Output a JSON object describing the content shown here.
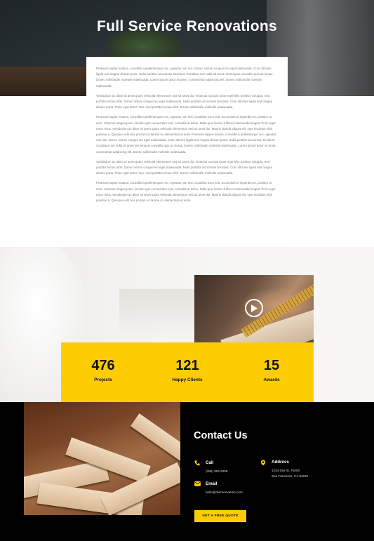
{
  "hero": {
    "title": "Full Service Renovations"
  },
  "content": {
    "paragraphs": [
      "Praesent sapien massa, convallis a pellentesque nec, egestas non nisi. Donec rutrum congue leo eget malesuada. Cras ultricies ligula sed magna dictum porta. Nulla porttitor accumsan tincidunt. Curabitur non nulla sit amet nisl tempus convallis quis ac lectus. Donec sollicitudin molestie malesuada. Lorem ipsum dolor sit amet, consectetur adipiscing elit. Donec sollicitudin molestie malesuada.",
      "Vestibulum ac diam sit amet quam vehicula elementum sed sit amet dui. Vivamus suscipit tortor eget felis porttitor volutpat. Sed porttitor lectus nibh. Donec rutrum congue leo eget malesuada. Nulla porttitor accumsan tincidunt. Cras ultricies ligula sed magna dictum porta. Proin eget tortor risus. Sed porttitor lectus nibh. Donec sollicitudin molestie malesuada.",
      "Praesent sapien massa, convallis a pellentesque nec, egestas non nisi. Curabitur arcu erat, accumsan id imperdiet et, porttitor at sem. Vivamus magna justo, lacinia eget consectetur sed, convallis at tellus. Nulla quis lorem ut libero malesuada feugiat. Proin eget tortor risus. Vestibulum ac diam sit amet quam vehicula elementum sed sit amet dui. Mauris blandit aliquet elit, eget tincidunt nibh pulvinar a. Quisque velit nisi, pretium ut lacinia in, elementum id enim Praesent sapien massa, convallis a pellentesque nec, egestas non nisi. Donec rutrum congue leo eget malesuada. Cras ultricies ligula sed magna dictum porta. Nulla porttitor accumsan tincidunt. Curabitur non nulla sit amet nisl tempus convallis quis ac lectus. Donec sollicitudin molestie malesuada. Lorem ipsum dolor sit amet, consectetur adipiscing elit. Donec sollicitudin molestie malesuada.",
      "Vestibulum ac diam sit amet quam vehicula elementum sed sit amet dui. Vivamus suscipit tortor eget felis porttitor volutpat. Sed porttitor lectus nibh. Donec rutrum congue leo eget malesuada. Nulla porttitor accumsan tincidunt. Cras ultricies ligula sed magna dictum porta. Proin eget tortor risus. Sed porttitor lectus nibh. Donec sollicitudin molestie malesuada.",
      "Praesent sapien massa, convallis a pellentesque nec, egestas non nisi. Curabitur arcu erat, accumsan id imperdiet et, porttitor at sem. Vivamus magna justo, lacinia eget consectetur sed, convallis at tellus. Nulla quis lorem ut libero malesuada feugiat. Proin eget tortor risus. Vestibulum ac diam sit amet quam vehicula elementum sed sit amet dui. Mauris blandit aliquet elit, eget tincidunt nibh pulvinar a. Quisque velit nisi, pretium ut lacinia in, elementum id enim."
    ]
  },
  "video": {
    "play_icon": "play-circle-icon"
  },
  "stats": [
    {
      "number": "476",
      "label": "Projects"
    },
    {
      "number": "121",
      "label": "Happy Clients"
    },
    {
      "number": "15",
      "label": "Awards"
    }
  ],
  "contact": {
    "title": "Contact Us",
    "call": {
      "label": "Call",
      "value": "(255) 352-6258",
      "icon": "phone-icon"
    },
    "address": {
      "label": "Address",
      "line1": "1234 Divi St. #1000",
      "line2": "San Francisco, CA 94220",
      "icon": "map-pin-icon"
    },
    "email": {
      "label": "Email",
      "value": "hello@divirenovation.com",
      "icon": "envelope-icon"
    },
    "button_label": "GET A FREE QUOTE"
  },
  "colors": {
    "accent": "#fecc03",
    "dark": "#000000",
    "text": "#7a7a7a"
  }
}
